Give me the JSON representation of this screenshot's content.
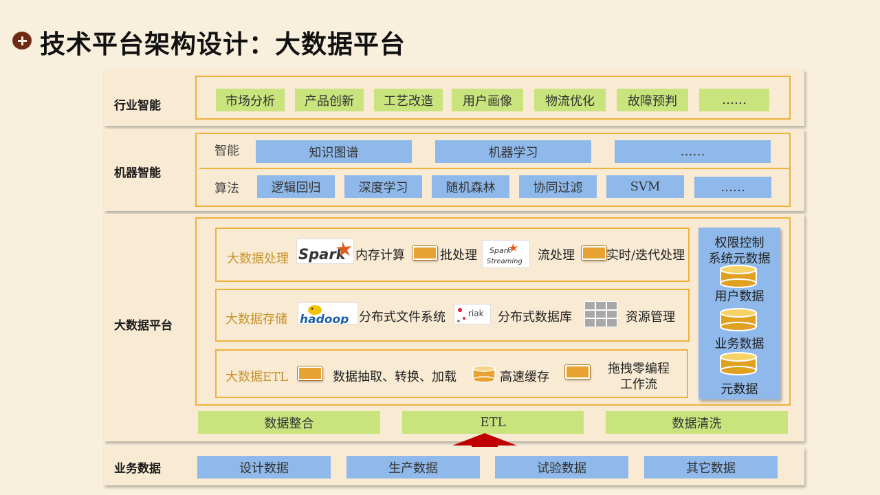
{
  "title": "技术平台架构设计：大数据平台",
  "industry": {
    "label": "行业智能",
    "items": [
      "市场分析",
      "产品创新",
      "工艺改造",
      "用户画像",
      "物流优化",
      "故障预判",
      "……"
    ]
  },
  "machine": {
    "label": "机器智能",
    "intel_label": "智能",
    "intel_items": [
      "知识图谱",
      "机器学习",
      "……"
    ],
    "algo_label": "算法",
    "algo_items": [
      "逻辑回归",
      "深度学习",
      "随机森林",
      "协同过滤",
      "SVM",
      "……"
    ]
  },
  "platform": {
    "label": "大数据平台",
    "processing": {
      "label": "大数据处理",
      "spark_logo": "Spark",
      "memory": "内存计算",
      "batch": "批处理",
      "streaming_logo_1": "Spark",
      "streaming_logo_2": "Streaming",
      "stream": "流处理",
      "realtime": "实时/迭代处理"
    },
    "storage": {
      "label": "大数据存储",
      "hadoop_logo": "hadoop",
      "dfs": "分布式文件系统",
      "riak_logo": "riak",
      "ddb": "分布式数据库",
      "resource": "资源管理"
    },
    "etl": {
      "label": "大数据ETL",
      "extract": "数据抽取、转换、加载",
      "cache": "高速缓存",
      "drag_1": "拖拽零编程",
      "drag_2": "工作流"
    },
    "side": {
      "title_1": "权限控制",
      "title_2": "系统元数据",
      "user": "用户数据",
      "business": "业务数据",
      "meta": "元数据"
    },
    "integration": [
      "数据整合",
      "ETL",
      "数据清洗"
    ]
  },
  "business": {
    "label": "业务数据",
    "items": [
      "设计数据",
      "生产数据",
      "试验数据",
      "其它数据"
    ]
  },
  "colors": {
    "background": "#f9efdd",
    "band": "#f8ead3",
    "orange_border": "#f0b13c",
    "green": "#c9e37d",
    "blue": "#8fb9ea",
    "arrow": "#c00000"
  }
}
